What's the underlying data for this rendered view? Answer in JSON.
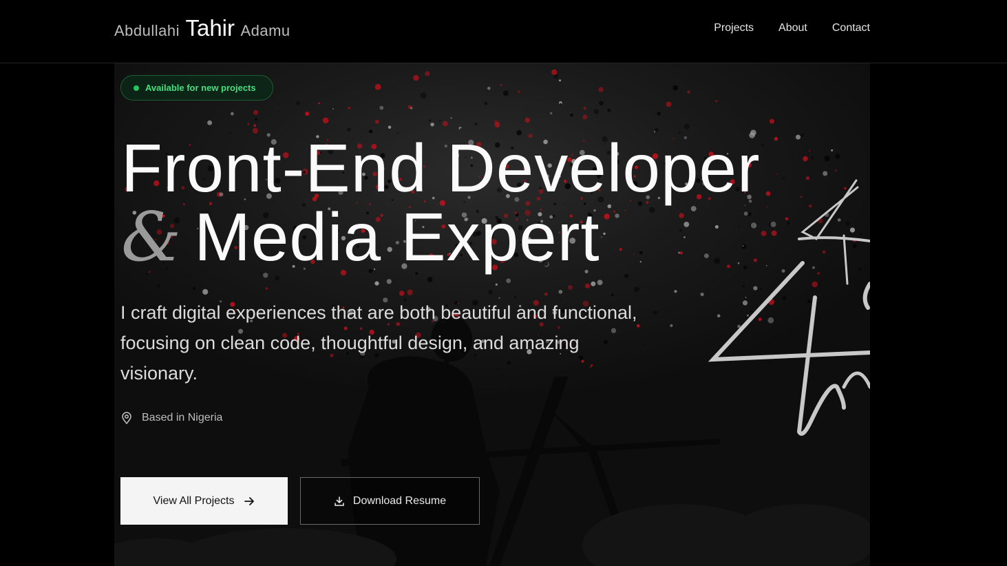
{
  "header": {
    "brand": {
      "first": "Abdullahi",
      "middle": "Tahir",
      "last": "Adamu"
    },
    "nav": [
      {
        "label": "Projects"
      },
      {
        "label": "About"
      },
      {
        "label": "Contact"
      }
    ]
  },
  "hero": {
    "badge": "Available for new projects",
    "title_line1": "Front-End Developer",
    "title_amp": "&",
    "title_line2": "Media Expert",
    "lead": "I craft digital experiences that are both beautiful and functional, focusing on clean code, thoughtful design, and amazing visionary.",
    "location": "Based in Nigeria",
    "primary_button": "View All Projects",
    "secondary_button": "Download Resume"
  },
  "icons": {
    "badge": "status-dot-icon",
    "location": "map-pin-icon",
    "primary": "arrow-right-icon",
    "secondary": "download-icon"
  },
  "colors": {
    "background": "#000000",
    "badge_text": "#4ade80",
    "badge_dot": "#22c55e",
    "splatter_red": "#b5121b",
    "button_light": "#f4f4f4"
  }
}
